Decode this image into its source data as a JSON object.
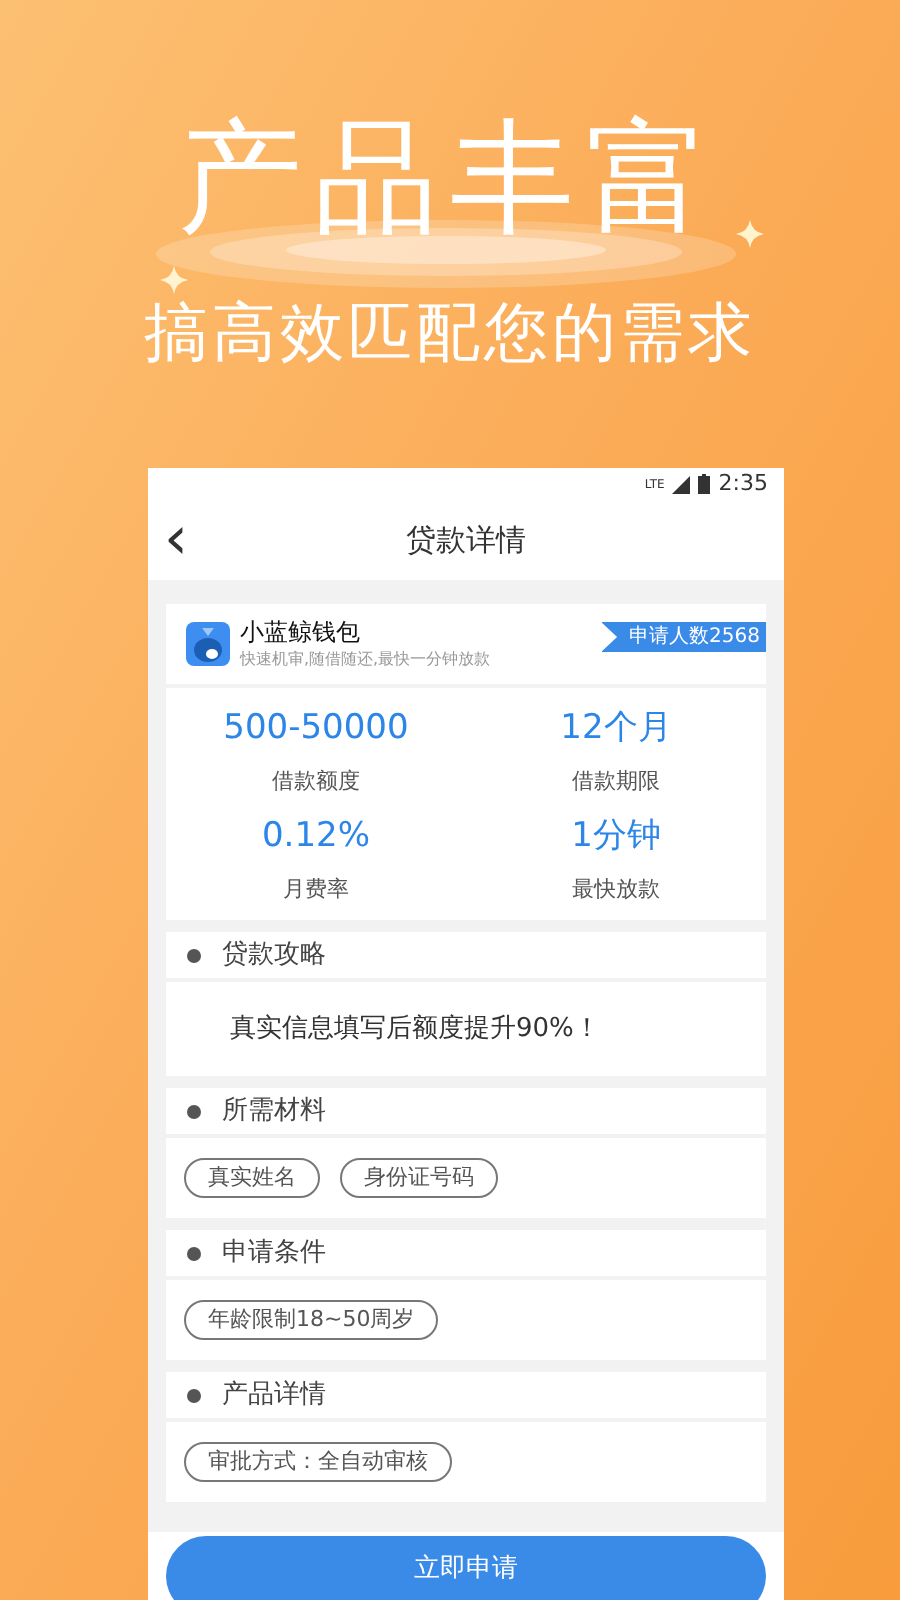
{
  "promo": {
    "title": "产品丰富",
    "subtitle": "搞高效匹配您的需求"
  },
  "status_bar": {
    "time": "2:35",
    "network": "LTE"
  },
  "nav": {
    "back": "‹",
    "title": "贷款详情"
  },
  "product": {
    "name": "小蓝鲸钱包",
    "tagline": "快速机审,随借随还,最快一分钟放款",
    "badge": "申请人数2568"
  },
  "stats": [
    {
      "value": "500-50000",
      "label": "借款额度"
    },
    {
      "value": "12个月",
      "label": "借款期限"
    },
    {
      "value": "0.12%",
      "label": "月费率"
    },
    {
      "value": "1分钟",
      "label": "最快放款"
    }
  ],
  "sections": [
    {
      "title": "贷款攻略",
      "kind": "text",
      "text": "真实信息填写后额度提升90%！"
    },
    {
      "title": "所需材料",
      "kind": "tags",
      "tags": [
        "真实姓名",
        "身份证号码"
      ]
    },
    {
      "title": "申请条件",
      "kind": "tags",
      "tags": [
        "年龄限制18~50周岁"
      ]
    },
    {
      "title": "产品详情",
      "kind": "tags",
      "tags": [
        "审批方式：全自动审核"
      ]
    }
  ],
  "apply_button": "立即申请"
}
